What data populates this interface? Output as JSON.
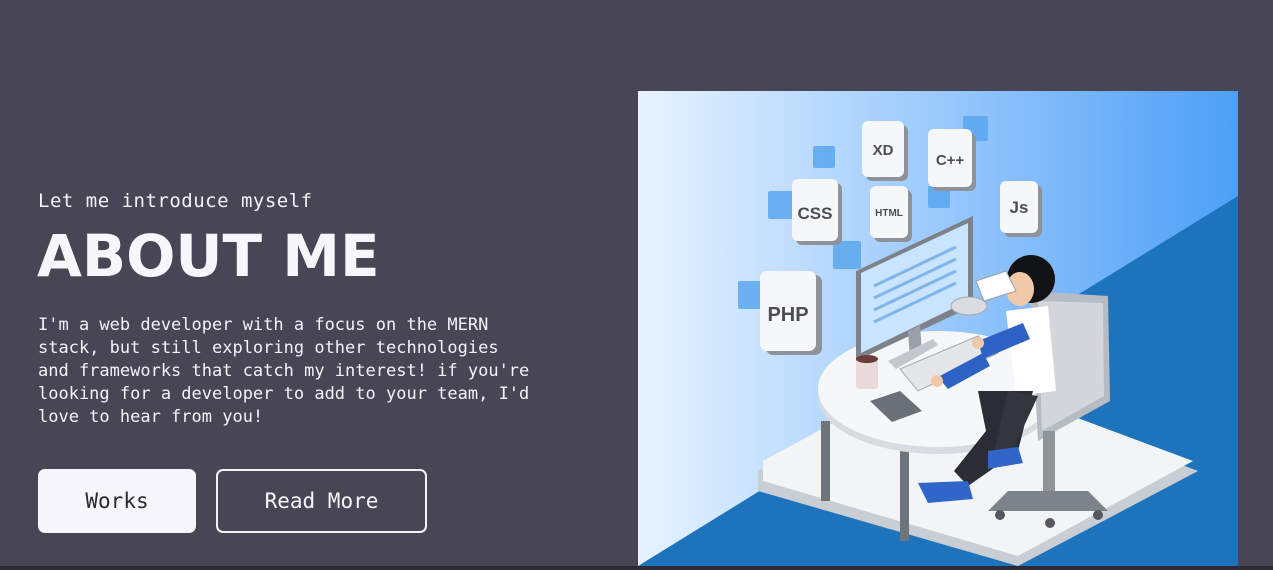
{
  "about": {
    "intro": "Let me introduce myself",
    "title": "ABOUT ME",
    "bio": "I'm a web developer with a focus on the MERN stack, but still exploring other technologies and frameworks that catch my interest! if you're looking for a developer to add to your team, I'd love to hear from you!"
  },
  "buttons": {
    "works_label": "Works",
    "read_more_label": "Read More"
  },
  "illustration": {
    "tech_tiles": [
      "CSS",
      "XD",
      "C++",
      "HTML",
      "Js",
      "PHP"
    ]
  },
  "colors": {
    "background": "#484654",
    "accent_blue": "#1f76c0",
    "button_fill": "#f7f6fc"
  }
}
